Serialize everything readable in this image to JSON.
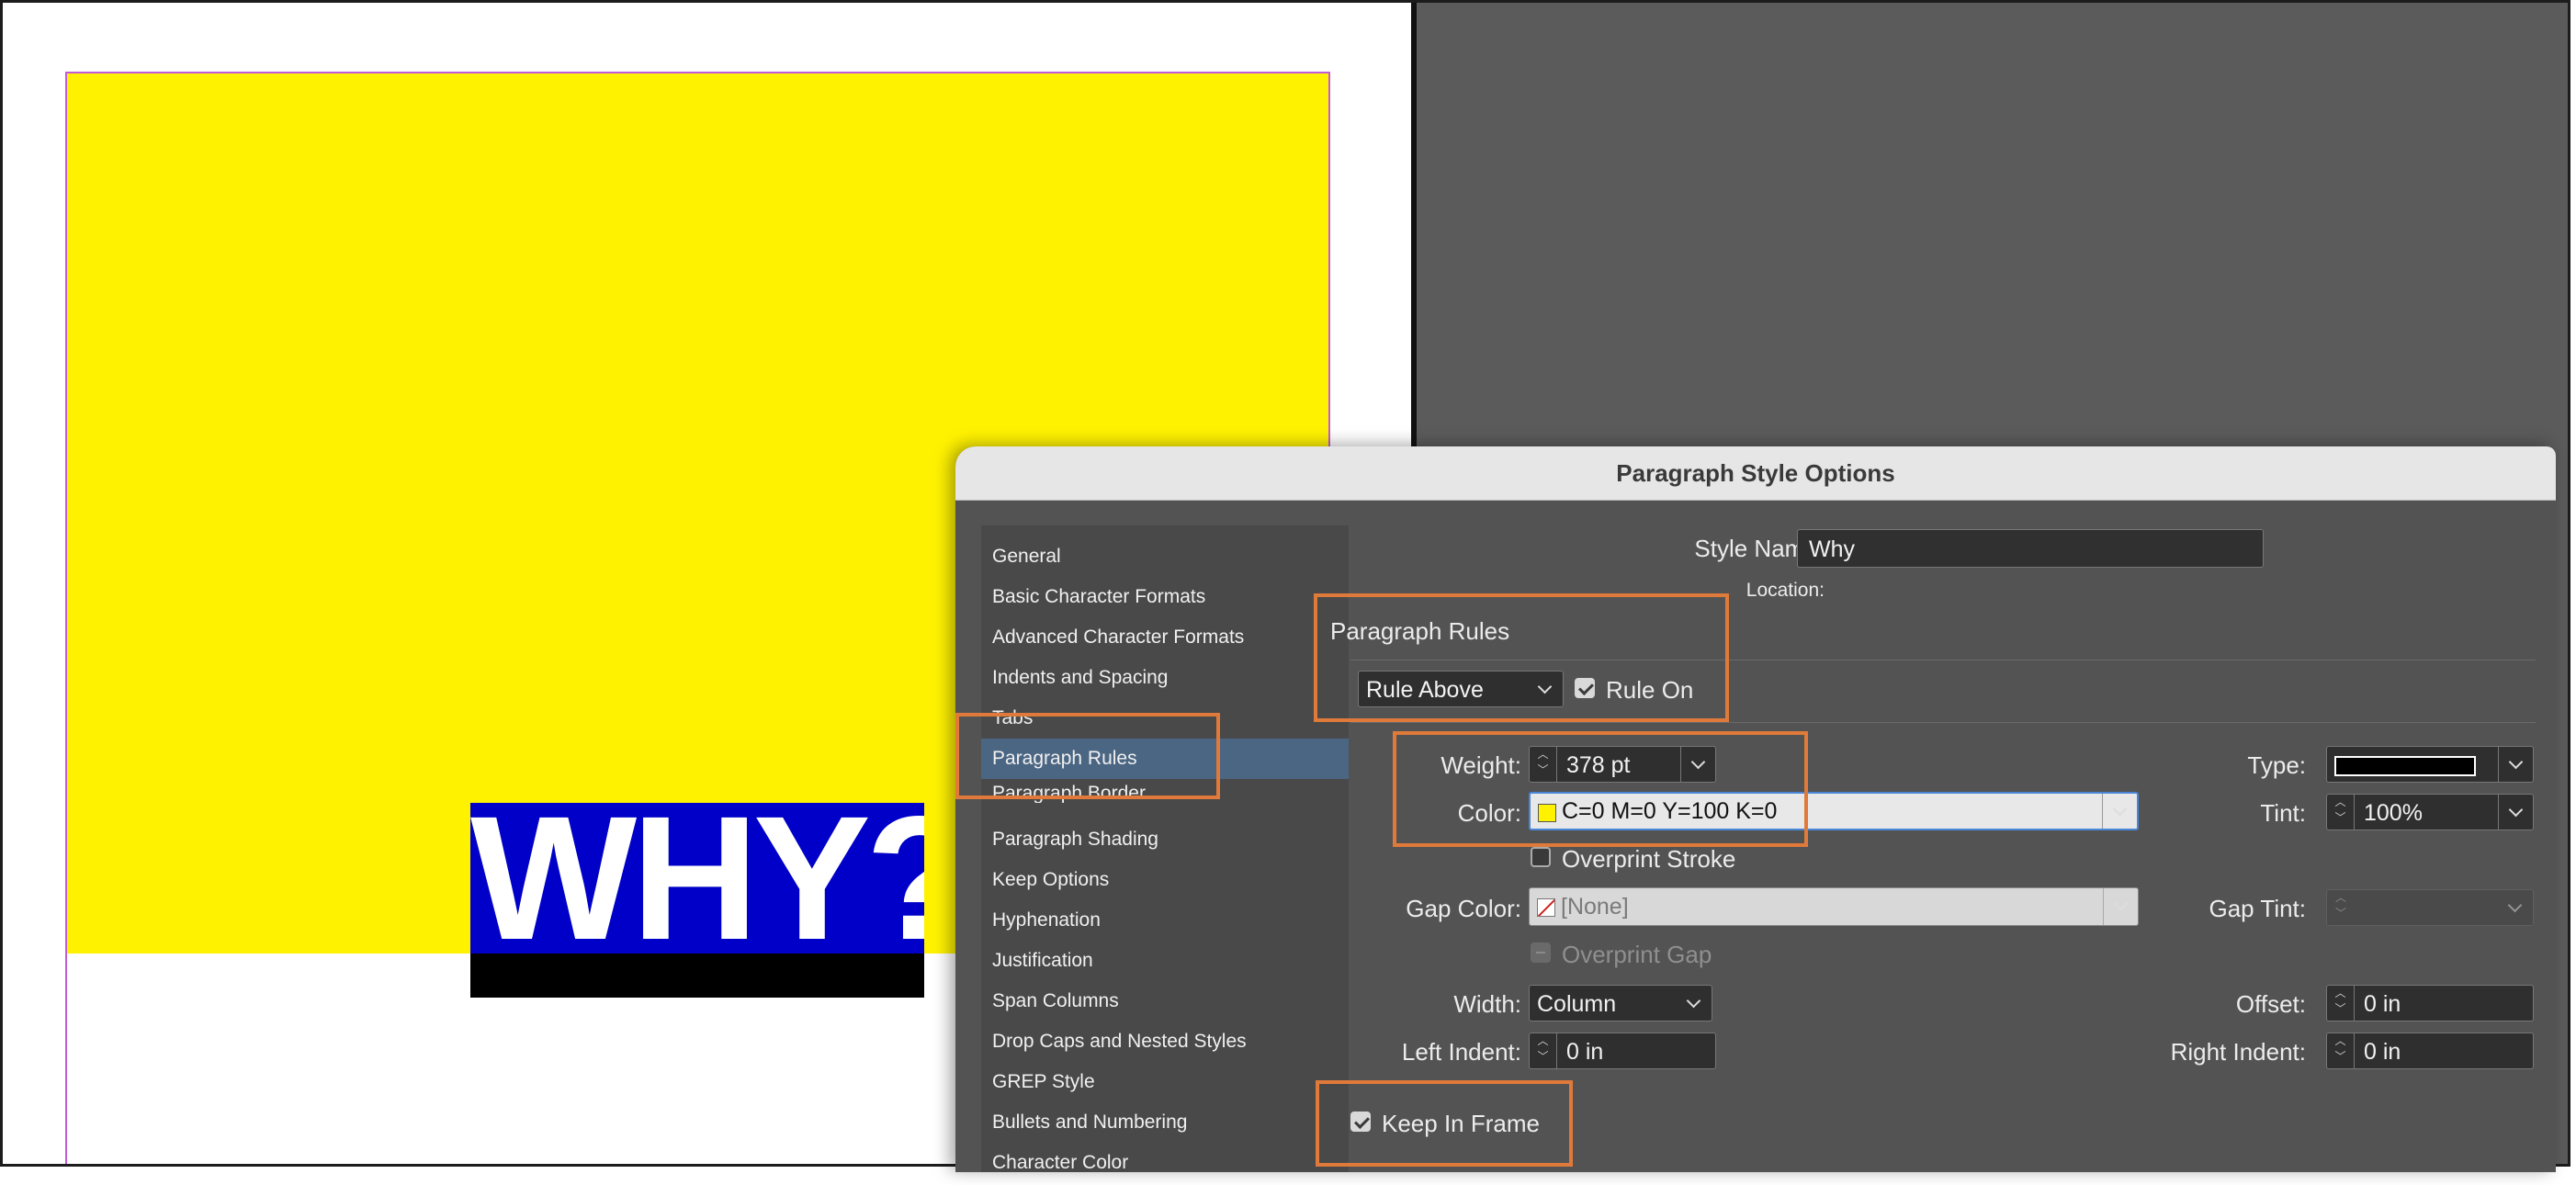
{
  "canvas": {
    "why_text": "WHY?",
    "colors": {
      "yellow": "#fff200",
      "blue": "#0000c8",
      "pasteboard": "#5b5b5b",
      "highlight": "#e07a3a"
    }
  },
  "dialog": {
    "title": "Paragraph Style Options",
    "sidebar": {
      "items": [
        {
          "label": "General"
        },
        {
          "label": "Basic Character Formats"
        },
        {
          "label": "Advanced Character Formats"
        },
        {
          "label": "Indents and Spacing"
        },
        {
          "label": "Tabs"
        },
        {
          "label": "Paragraph Rules",
          "selected": true
        },
        {
          "label": "Paragraph Border"
        },
        {
          "label": "Paragraph Shading"
        },
        {
          "label": "Keep Options"
        },
        {
          "label": "Hyphenation"
        },
        {
          "label": "Justification"
        },
        {
          "label": "Span Columns"
        },
        {
          "label": "Drop Caps and Nested Styles"
        },
        {
          "label": "GREP Style"
        },
        {
          "label": "Bullets and Numbering"
        },
        {
          "label": "Character Color"
        }
      ]
    },
    "style_name_label": "Style Name:",
    "style_name_value": "Why",
    "location_label": "Location:",
    "section_title": "Paragraph Rules",
    "rule_select": "Rule Above",
    "rule_on_label": "Rule On",
    "rule_on_checked": true,
    "weight_label": "Weight:",
    "weight_value": "378 pt",
    "type_label": "Type:",
    "color_label": "Color:",
    "color_value": "C=0 M=0 Y=100 K=0",
    "tint_label": "Tint:",
    "tint_value": "100%",
    "overprint_stroke_label": "Overprint Stroke",
    "overprint_stroke_checked": false,
    "gap_color_label": "Gap Color:",
    "gap_color_value": "[None]",
    "gap_tint_label": "Gap Tint:",
    "overprint_gap_label": "Overprint Gap",
    "width_label": "Width:",
    "width_value": "Column",
    "offset_label": "Offset:",
    "offset_value": "0 in",
    "left_indent_label": "Left Indent:",
    "left_indent_value": "0 in",
    "right_indent_label": "Right Indent:",
    "right_indent_value": "0 in",
    "keep_in_frame_label": "Keep In Frame",
    "keep_in_frame_checked": true
  }
}
